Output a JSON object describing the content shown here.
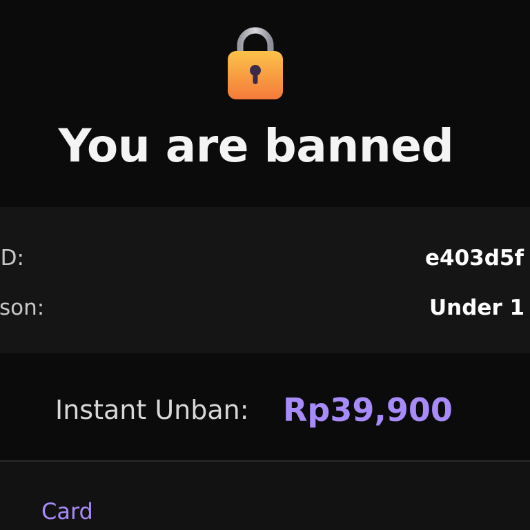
{
  "header": {
    "icon": "lock-icon",
    "title": "You are banned"
  },
  "ban_info": {
    "rows": [
      {
        "label": "n ID:",
        "value": "e403d5f"
      },
      {
        "label": "ason:",
        "value": "Under 1"
      }
    ]
  },
  "unban": {
    "label": "Instant Unban:",
    "price": "Rp39,900"
  },
  "payment": {
    "tabs": [
      {
        "label": "Card"
      }
    ]
  },
  "colors": {
    "background": "#0b0b0b",
    "panel": "#151515",
    "accent": "#a78bfa",
    "lock_body": "#f6a23b",
    "lock_shackle": "#a9a9b2"
  }
}
